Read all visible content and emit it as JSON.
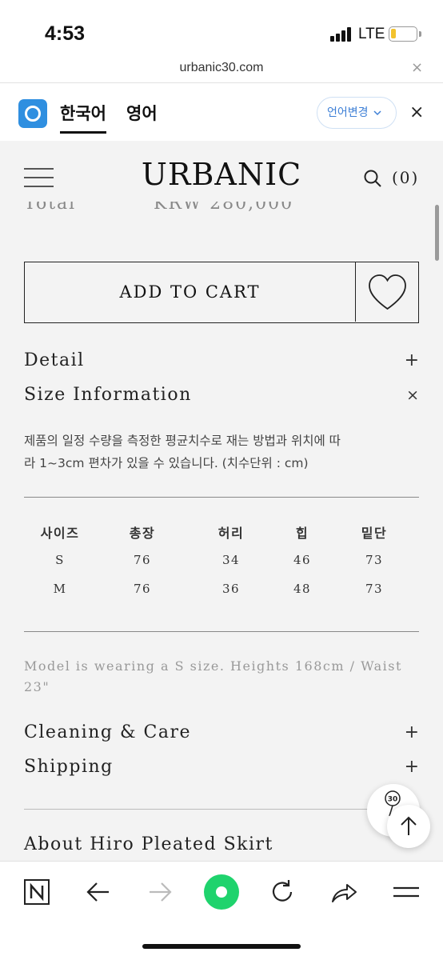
{
  "status_bar": {
    "time": "4:53",
    "network": "LTE"
  },
  "browser": {
    "url": "urbanic30.com",
    "url_close": "×"
  },
  "language_bar": {
    "tab_korean": "한국어",
    "tab_english": "영어",
    "change_label": "언어변경",
    "close": "×"
  },
  "header": {
    "logo": "URBANIC",
    "cart_count": "(0)"
  },
  "total": {
    "label": "Total",
    "value": "KRW 280,000"
  },
  "product": {
    "add_to_cart": "ADD TO CART"
  },
  "accordions": {
    "detail": {
      "label": "Detail",
      "icon": "+"
    },
    "size_info": {
      "label": "Size Information",
      "icon": "×"
    },
    "cleaning": {
      "label": "Cleaning & Care",
      "icon": "+"
    },
    "shipping": {
      "label": "Shipping",
      "icon": "+"
    },
    "about": {
      "label": "About Hiro Pleated Skirt"
    }
  },
  "size_info": {
    "description_line1": "제품의 일정 수량을 측정한 평균치수로 재는 방법과 위치에 따",
    "description_line2": "라 1~3cm 편차가 있을 수 있습니다. (치수단위 : cm)",
    "table": {
      "headers": [
        "사이즈",
        "총장",
        "허리",
        "힙",
        "밑단"
      ],
      "rows": [
        [
          "S",
          "76",
          "34",
          "46",
          "73"
        ],
        [
          "M",
          "76",
          "36",
          "48",
          "73"
        ]
      ]
    },
    "model_note": "Model is wearing a S size. Heights 168cm / Waist 23\""
  },
  "floating": {
    "badge": "30"
  }
}
